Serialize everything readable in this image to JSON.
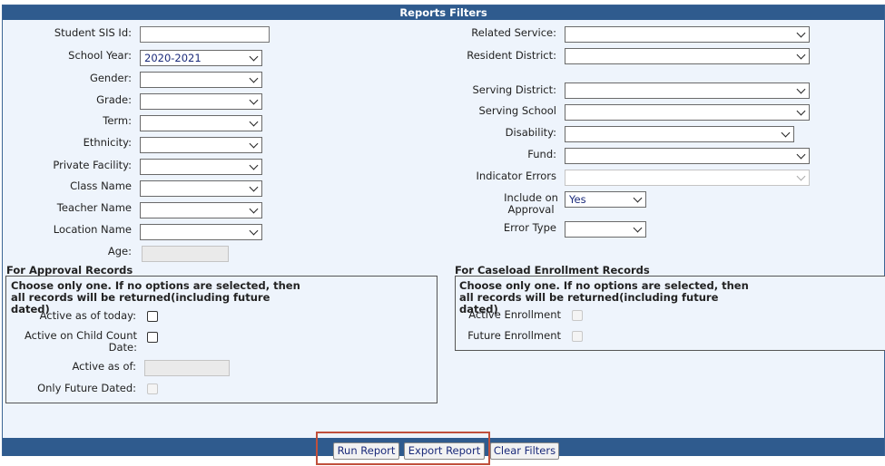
{
  "header": {
    "title": "Reports Filters"
  },
  "left_fields": {
    "student_sis_id": {
      "label": "Student SIS Id:",
      "value": ""
    },
    "school_year": {
      "label": "School Year:",
      "value": "2020-2021"
    },
    "gender": {
      "label": "Gender:",
      "value": ""
    },
    "grade": {
      "label": "Grade:",
      "value": ""
    },
    "term": {
      "label": "Term:",
      "value": ""
    },
    "ethnicity": {
      "label": "Ethnicity:",
      "value": ""
    },
    "private_facility": {
      "label": "Private Facility:",
      "value": ""
    },
    "class_name": {
      "label": "Class Name",
      "value": ""
    },
    "teacher_name": {
      "label": "Teacher Name",
      "value": ""
    },
    "location_name": {
      "label": "Location Name",
      "value": ""
    },
    "age": {
      "label": "Age:",
      "value": ""
    }
  },
  "right_fields": {
    "related_service": {
      "label": "Related Service:",
      "value": ""
    },
    "resident_district": {
      "label": "Resident District:",
      "value": ""
    },
    "serving_district": {
      "label": "Serving District:",
      "value": ""
    },
    "serving_school": {
      "label": "Serving School",
      "value": ""
    },
    "disability": {
      "label": "Disability:",
      "value": ""
    },
    "fund": {
      "label": "Fund:",
      "value": ""
    },
    "indicator_errors": {
      "label": "Indicator Errors",
      "value": ""
    },
    "include_on_approval": {
      "label": "Include on Approval",
      "value": "Yes"
    },
    "error_type": {
      "label": "Error Type",
      "value": ""
    }
  },
  "approval": {
    "title": "For Approval Records",
    "note": "Choose only one. If no options are selected, then all records will be returned(including future dated)",
    "active_today": "Active as of today:",
    "active_child_count": "Active on Child Count Date:",
    "active_as_of": "Active as of:",
    "only_future": "Only Future Dated:"
  },
  "caseload": {
    "title": "For Caseload Enrollment Records",
    "note": "Choose only one. If no options are selected, then all records will be returned(including future dated)",
    "active_enrollment": "Active Enrollment",
    "future_enrollment": "Future Enrollment"
  },
  "buttons": {
    "run": "Run Report",
    "export": "Export Report",
    "clear": "Clear Filters"
  }
}
